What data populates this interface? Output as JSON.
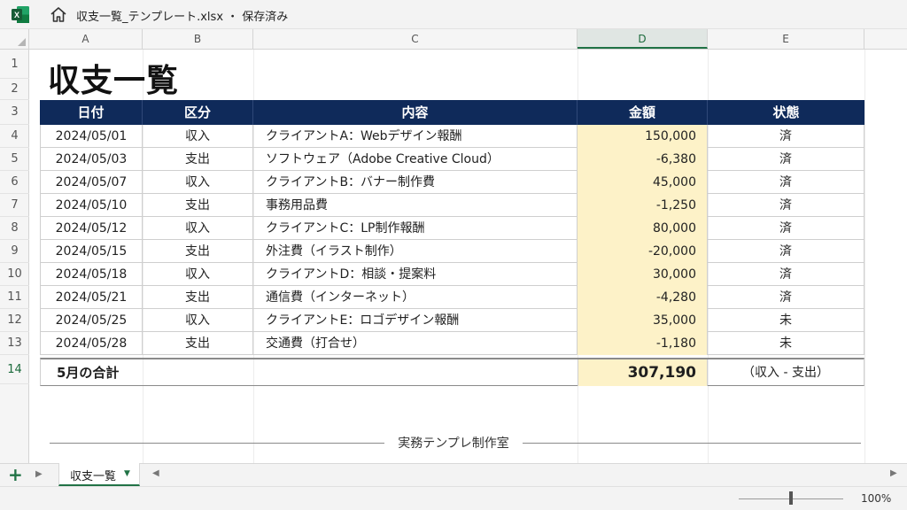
{
  "window": {
    "title": "収支一覧_テンプレート.xlsx ・ 保存済み"
  },
  "grid": {
    "columns": [
      "A",
      "B",
      "C",
      "D",
      "E"
    ],
    "active_column": "D",
    "rows": [
      "1",
      "2",
      "3",
      "4",
      "5",
      "6",
      "7",
      "8",
      "9",
      "10",
      "11",
      "12",
      "13",
      "14"
    ]
  },
  "sheet": {
    "title": "収支一覧",
    "headers": {
      "date": "日付",
      "type": "区分",
      "description": "内容",
      "amount": "金額",
      "status": "状態"
    },
    "rows": [
      {
        "date": "2024/05/01",
        "type": "収入",
        "description": "クライアントA：Webデザイン報酬",
        "amount": "150,000",
        "status": "済"
      },
      {
        "date": "2024/05/03",
        "type": "支出",
        "description": "ソフトウェア（Adobe Creative Cloud）",
        "amount": "-6,380",
        "status": "済"
      },
      {
        "date": "2024/05/07",
        "type": "収入",
        "description": "クライアントB：バナー制作費",
        "amount": "45,000",
        "status": "済"
      },
      {
        "date": "2024/05/10",
        "type": "支出",
        "description": "事務用品費",
        "amount": "-1,250",
        "status": "済"
      },
      {
        "date": "2024/05/12",
        "type": "収入",
        "description": "クライアントC：LP制作報酬",
        "amount": "80,000",
        "status": "済"
      },
      {
        "date": "2024/05/15",
        "type": "支出",
        "description": "外注費（イラスト制作）",
        "amount": "-20,000",
        "status": "済"
      },
      {
        "date": "2024/05/18",
        "type": "収入",
        "description": "クライアントD：相談・提案料",
        "amount": "30,000",
        "status": "済"
      },
      {
        "date": "2024/05/21",
        "type": "支出",
        "description": "通信費（インターネット）",
        "amount": "-4,280",
        "status": "済"
      },
      {
        "date": "2024/05/25",
        "type": "収入",
        "description": "クライアントE：ロゴデザイン報酬",
        "amount": "35,000",
        "status": "未"
      },
      {
        "date": "2024/05/28",
        "type": "支出",
        "description": "交通費（打合せ）",
        "amount": "-1,180",
        "status": "未"
      }
    ],
    "total": {
      "label": "5月の合計",
      "amount": "307,190",
      "note": "（収入 - 支出）"
    },
    "footer": "実務テンプレ制作室"
  },
  "tabs": {
    "add": "+",
    "active": "収支一覧"
  },
  "status": {
    "zoom": "100%",
    "zoom_level": 0.5
  },
  "colors": {
    "header_bg": "#0f2a5a",
    "amount_bg": "#fdf2c8",
    "excel_green": "#217346"
  }
}
